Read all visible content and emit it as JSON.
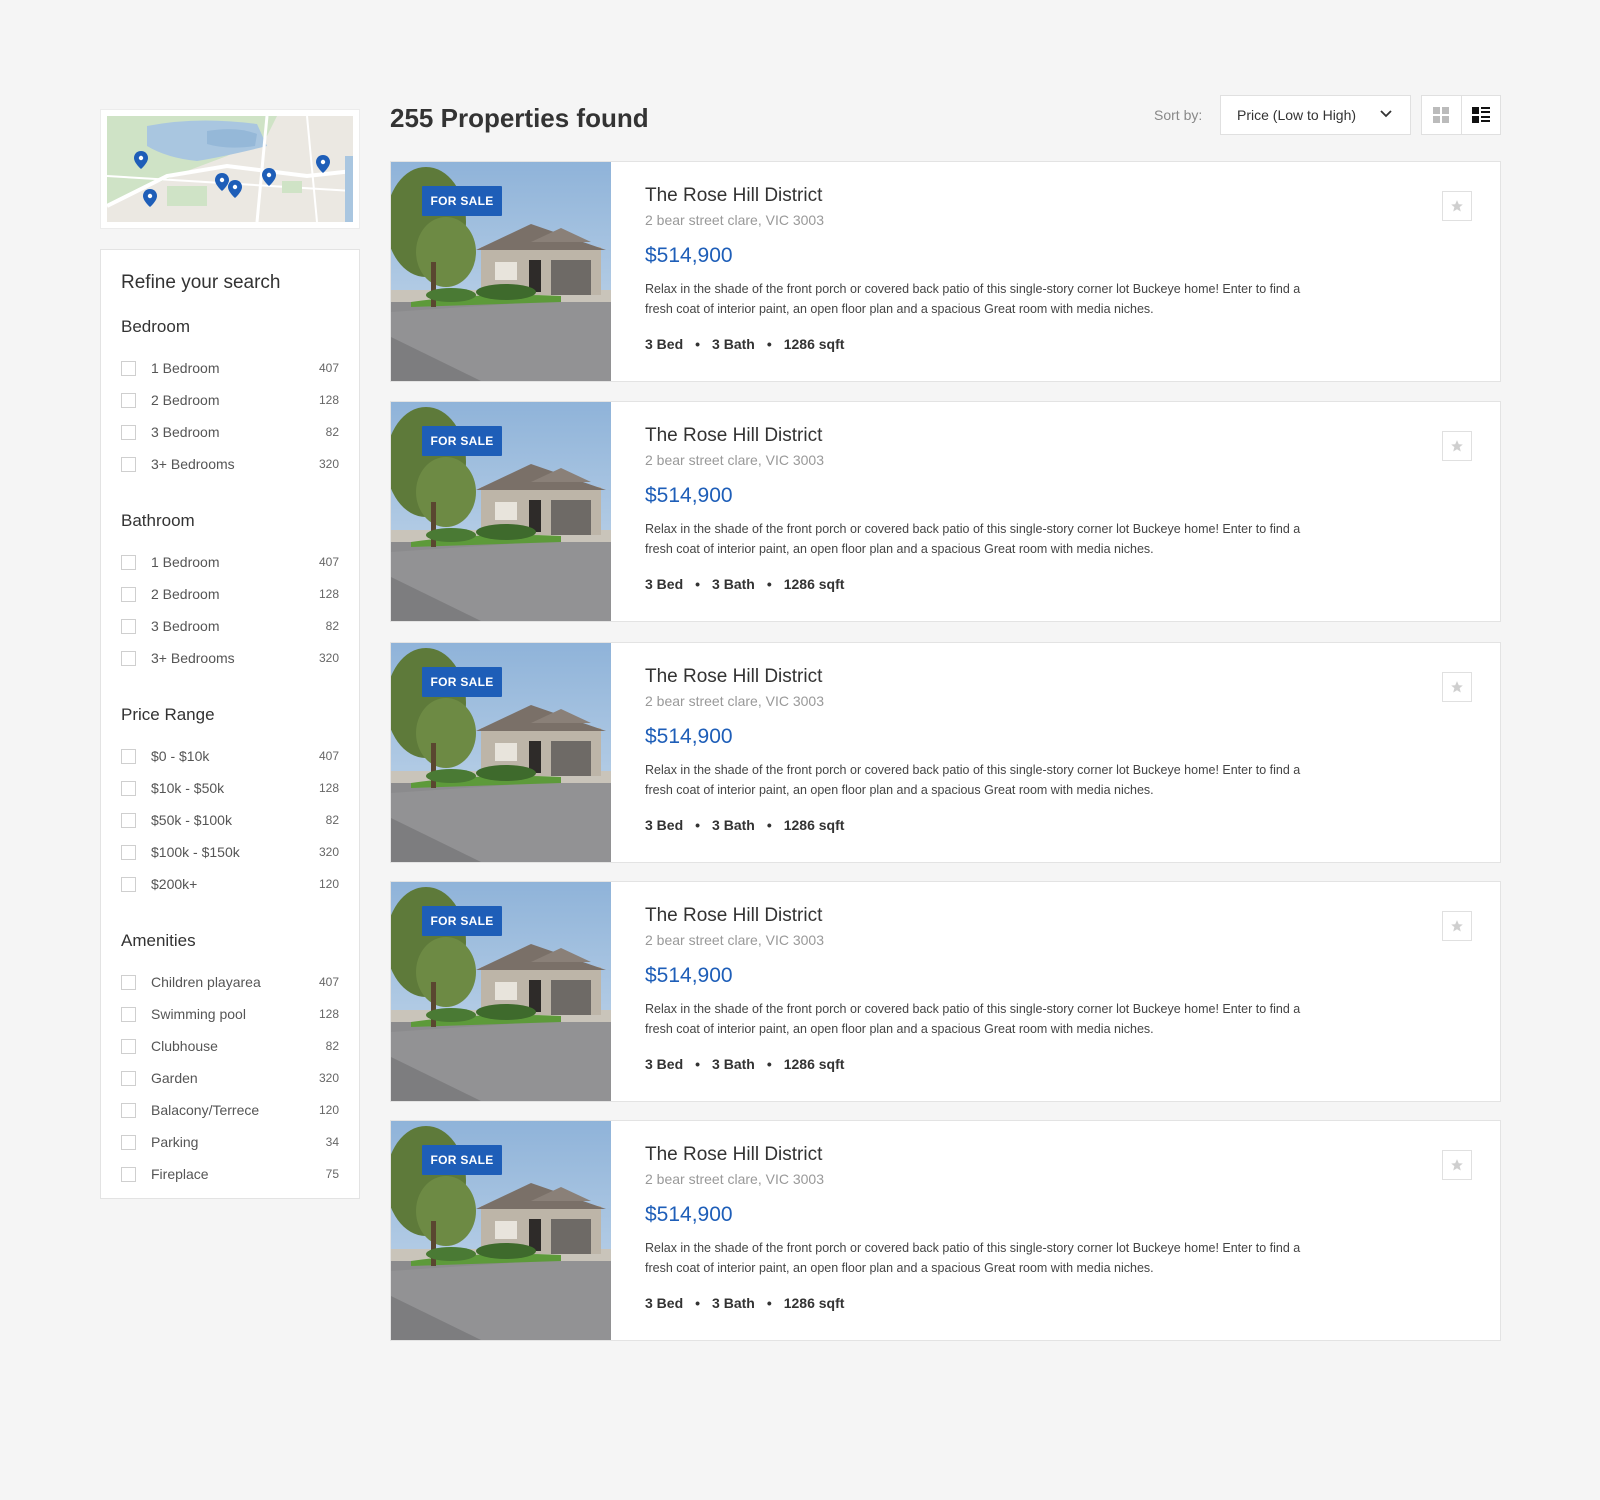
{
  "results": {
    "count_title": "255 Properties found"
  },
  "sort": {
    "label": "Sort by:",
    "selected": "Price (Low to High)"
  },
  "view_toggle": {
    "options": [
      "grid-view",
      "list-view"
    ],
    "active": "list-view"
  },
  "colors": {
    "accent": "#1e5eb8",
    "background": "#f5f5f5",
    "card": "#ffffff",
    "map_pin": "#1e5eb8"
  },
  "filters": {
    "title": "Refine your search",
    "groups": [
      {
        "title": "Bedroom",
        "options": [
          {
            "label": "1 Bedroom",
            "count": "407"
          },
          {
            "label": "2 Bedroom",
            "count": "128"
          },
          {
            "label": "3 Bedroom",
            "count": "82"
          },
          {
            "label": "3+ Bedrooms",
            "count": "320"
          }
        ]
      },
      {
        "title": "Bathroom",
        "options": [
          {
            "label": "1 Bedroom",
            "count": "407"
          },
          {
            "label": "2 Bedroom",
            "count": "128"
          },
          {
            "label": "3 Bedroom",
            "count": "82"
          },
          {
            "label": "3+ Bedrooms",
            "count": "320"
          }
        ]
      },
      {
        "title": "Price Range",
        "options": [
          {
            "label": "$0 - $10k",
            "count": "407"
          },
          {
            "label": "$10k - $50k",
            "count": "128"
          },
          {
            "label": "$50k - $100k",
            "count": "82"
          },
          {
            "label": "$100k - $150k",
            "count": "320"
          },
          {
            "label": "$200k+",
            "count": "120"
          }
        ]
      },
      {
        "title": "Amenities",
        "options": [
          {
            "label": "Children playarea",
            "count": "407"
          },
          {
            "label": "Swimming pool",
            "count": "128"
          },
          {
            "label": "Clubhouse",
            "count": "82"
          },
          {
            "label": "Garden",
            "count": "320"
          },
          {
            "label": "Balacony/Terrece",
            "count": "120"
          },
          {
            "label": "Parking",
            "count": "34"
          },
          {
            "label": "Fireplace",
            "count": "75"
          }
        ]
      }
    ]
  },
  "listings": [
    {
      "badge": "FOR SALE",
      "title": "The Rose Hill District",
      "address": "2 bear street clare, VIC 3003",
      "price": "$514,900",
      "description": "Relax in the shade of the front porch or covered back patio of this single-story corner lot Buckeye home! Enter to find a fresh coat of interior paint, an open floor plan and a spacious Great room with media niches.",
      "beds": "3 Bed",
      "baths": "3 Bath",
      "area": "1286 sqft"
    },
    {
      "badge": "FOR SALE",
      "title": "The Rose Hill District",
      "address": "2 bear street clare, VIC 3003",
      "price": "$514,900",
      "description": "Relax in the shade of the front porch or covered back patio of this single-story corner lot Buckeye home! Enter to find a fresh coat of interior paint, an open floor plan and a spacious Great room with media niches.",
      "beds": "3 Bed",
      "baths": "3 Bath",
      "area": "1286 sqft"
    },
    {
      "badge": "FOR SALE",
      "title": "The Rose Hill District",
      "address": "2 bear street clare, VIC 3003",
      "price": "$514,900",
      "description": "Relax in the shade of the front porch or covered back patio of this single-story corner lot Buckeye home! Enter to find a fresh coat of interior paint, an open floor plan and a spacious Great room with media niches.",
      "beds": "3 Bed",
      "baths": "3 Bath",
      "area": "1286 sqft"
    },
    {
      "badge": "FOR SALE",
      "title": "The Rose Hill District",
      "address": "2 bear street clare, VIC 3003",
      "price": "$514,900",
      "description": "Relax in the shade of the front porch or covered back patio of this single-story corner lot Buckeye home! Enter to find a fresh coat of interior paint, an open floor plan and a spacious Great room with media niches.",
      "beds": "3 Bed",
      "baths": "3 Bath",
      "area": "1286 sqft"
    },
    {
      "badge": "FOR SALE",
      "title": "The Rose Hill District",
      "address": "2 bear street clare, VIC 3003",
      "price": "$514,900",
      "description": "Relax in the shade of the front porch or covered back patio of this single-story corner lot Buckeye home! Enter to find a fresh coat of interior paint, an open floor plan and a spacious Great room with media niches.",
      "beds": "3 Bed",
      "baths": "3 Bath",
      "area": "1286 sqft"
    }
  ]
}
